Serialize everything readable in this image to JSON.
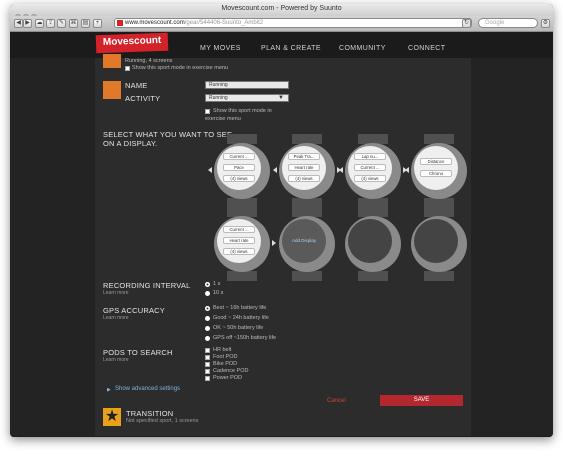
{
  "window": {
    "title": "Movescount.com - Powered by Suunto"
  },
  "toolbar": {
    "url_host": "www.movescount.com",
    "url_path": "/gear/544406-Suunto_Ambit2",
    "search_placeholder": "Google"
  },
  "nav": {
    "logo": "Movescount",
    "items": [
      "MY MOVES",
      "PLAN & CREATE",
      "COMMUNITY",
      "CONNECT"
    ]
  },
  "top_sport": {
    "summary": "Running, 4 screens",
    "show_menu": "Show this sport mode in exercise menu"
  },
  "form": {
    "name_label": "NAME",
    "name_value": "Running",
    "activity_label": "ACTIVITY",
    "activity_value": "Running",
    "show_menu": "Show this sport mode in",
    "show_menu_2": "exercise menu"
  },
  "displays": {
    "heading_1": "SELECT WHAT YOU WANT TO SEE",
    "heading_2": "ON A DISPLAY.",
    "watches": [
      {
        "fields": [
          "Current ...",
          "Pace",
          "(4) views"
        ]
      },
      {
        "fields": [
          "Peak Tra...",
          "Heart rate",
          "(4) views"
        ]
      },
      {
        "fields": [
          "Lap nu...",
          "Current ...",
          "(4) views"
        ]
      },
      {
        "fields": [
          "Distance",
          "Chrono"
        ]
      },
      {
        "fields": [
          "Current ...",
          "Heart rate",
          "(4) views"
        ]
      },
      {
        "add_label": "Add Display"
      },
      {},
      {}
    ]
  },
  "recording": {
    "label": "RECORDING INTERVAL",
    "learn": "Learn more",
    "options": [
      "1 s",
      "10 s"
    ]
  },
  "gps": {
    "label": "GPS ACCURACY",
    "learn": "Learn more",
    "options": [
      "Best ~ 16h battery life",
      "Good ~ 24h battery life",
      "OK ~ 50h battery life",
      "GPS off ~150h battery life"
    ]
  },
  "pods": {
    "label": "PODS TO SEARCH",
    "learn": "Learn more",
    "options": [
      "HR belt",
      "Foot POD",
      "Bike POD",
      "Cadence POD",
      "Power POD"
    ]
  },
  "advanced": {
    "label": "Show advanced settings"
  },
  "actions": {
    "cancel": "Cancel",
    "save": "SAVE"
  },
  "transition": {
    "title": "TRANSITION",
    "subtitle": "Not specified sport, 1 screens"
  },
  "colors": {
    "accent": "#d3222a",
    "save": "#b3282f",
    "panel": "#2c2c2c",
    "cancel_text": "#c9443a"
  }
}
